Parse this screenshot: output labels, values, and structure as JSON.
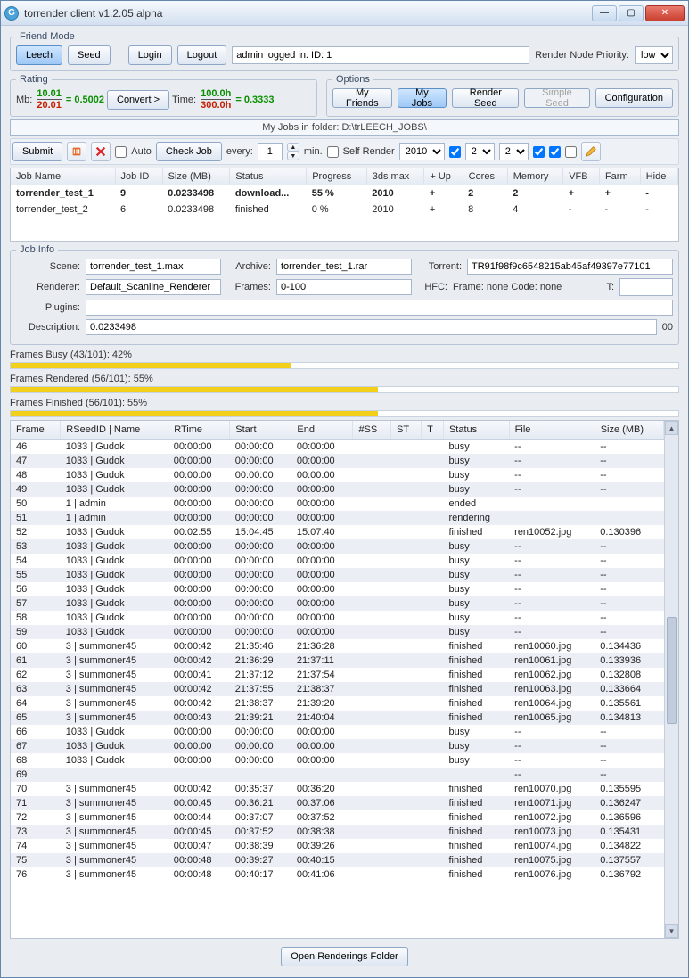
{
  "window": {
    "title": "torrender client v1.2.05 alpha"
  },
  "friendMode": {
    "legend": "Friend Mode",
    "leech": "Leech",
    "seed": "Seed",
    "login": "Login",
    "logout": "Logout",
    "status": "admin logged in. ID: 1",
    "priorityLabel": "Render Node Priority:",
    "priorityValue": "low"
  },
  "rating": {
    "legend": "Rating",
    "mbLabel": "Mb:",
    "mbTop": "10.01",
    "mbBot": "20.01",
    "mbEq": "= 0.5002",
    "convert": "Convert >",
    "timeLabel": "Time:",
    "timeTop": "100.0h",
    "timeBot": "300.0h",
    "timeEq": "= 0.3333"
  },
  "options": {
    "legend": "Options",
    "myFriends": "My Friends",
    "myJobs": "My Jobs",
    "renderSeed": "Render Seed",
    "simpleSeed": "Simple Seed",
    "configuration": "Configuration"
  },
  "jobs": {
    "path": "My Jobs in folder: D:\\trLEECH_JOBS\\",
    "submit": "Submit",
    "auto": "Auto",
    "checkJob": "Check Job",
    "every": "every:",
    "everyVal": "1",
    "min": "min.",
    "selfRender": "Self Render",
    "yearSel": "2010",
    "coresSel": "2",
    "memSel": "2",
    "headers": [
      "Job Name",
      "Job ID",
      "Size (MB)",
      "Status",
      "Progress",
      "3ds max",
      "+ Up",
      "Cores",
      "Memory",
      "VFB",
      "Farm",
      "Hide"
    ],
    "rows": [
      {
        "name": "torrender_test_1",
        "id": "9",
        "size": "0.0233498",
        "status": "download...",
        "prog": "55 %",
        "max": "2010",
        "up": "+",
        "cores": "2",
        "mem": "2",
        "vfb": "+",
        "farm": "+",
        "hide": "-",
        "bold": true
      },
      {
        "name": "torrender_test_2",
        "id": "6",
        "size": "0.0233498",
        "status": "finished",
        "prog": "0 %",
        "max": "2010",
        "up": "+",
        "cores": "8",
        "mem": "4",
        "vfb": "-",
        "farm": "-",
        "hide": "-",
        "bold": false
      }
    ]
  },
  "jobInfo": {
    "legend": "Job Info",
    "sceneL": "Scene:",
    "scene": "torrender_test_1.max",
    "archiveL": "Archive:",
    "archive": "torrender_test_1.rar",
    "torrentL": "Torrent:",
    "torrent": "TR91f98f9c6548215ab45af49397e77101",
    "rendererL": "Renderer:",
    "renderer": "Default_Scanline_Renderer",
    "framesL": "Frames:",
    "frames": "0-100",
    "hfcL": "HFC:",
    "hfc": "Frame: none Code: none",
    "tL": "T:",
    "t": "",
    "pluginsL": "Plugins:",
    "plugins": "",
    "descL": "Description:",
    "desc": "0.0233498",
    "descRight": "00"
  },
  "progress": {
    "busy": {
      "label": "Frames Busy (43/101): 42%",
      "pct": 42
    },
    "rendered": {
      "label": "Frames Rendered (56/101): 55%",
      "pct": 55
    },
    "finished": {
      "label": "Frames Finished (56/101): 55%",
      "pct": 55
    }
  },
  "frameHeaders": [
    "Frame",
    "RSeedID | Name",
    "RTime",
    "Start",
    "End",
    "#SS",
    "ST",
    "T",
    "Status",
    "File",
    "Size (MB)"
  ],
  "frames": [
    {
      "f": "46",
      "n": "1033 | Gudok",
      "rt": "00:00:00",
      "s": "00:00:00",
      "e": "00:00:00",
      "ss": "",
      "st": "",
      "t": "",
      "stat": "busy",
      "file": "--",
      "sz": "--"
    },
    {
      "f": "47",
      "n": "1033 | Gudok",
      "rt": "00:00:00",
      "s": "00:00:00",
      "e": "00:00:00",
      "ss": "",
      "st": "",
      "t": "",
      "stat": "busy",
      "file": "--",
      "sz": "--"
    },
    {
      "f": "48",
      "n": "1033 | Gudok",
      "rt": "00:00:00",
      "s": "00:00:00",
      "e": "00:00:00",
      "ss": "",
      "st": "",
      "t": "",
      "stat": "busy",
      "file": "--",
      "sz": "--"
    },
    {
      "f": "49",
      "n": "1033 | Gudok",
      "rt": "00:00:00",
      "s": "00:00:00",
      "e": "00:00:00",
      "ss": "",
      "st": "",
      "t": "",
      "stat": "busy",
      "file": "--",
      "sz": "--"
    },
    {
      "f": "50",
      "n": "1 | admin",
      "rt": "00:00:00",
      "s": "00:00:00",
      "e": "00:00:00",
      "ss": "",
      "st": "",
      "t": "",
      "stat": "ended",
      "file": "",
      "sz": ""
    },
    {
      "f": "51",
      "n": "1 | admin",
      "rt": "00:00:00",
      "s": "00:00:00",
      "e": "00:00:00",
      "ss": "",
      "st": "",
      "t": "",
      "stat": "rendering",
      "file": "",
      "sz": ""
    },
    {
      "f": "52",
      "n": "1033 | Gudok",
      "rt": "00:02:55",
      "s": "15:04:45",
      "e": "15:07:40",
      "ss": "",
      "st": "",
      "t": "",
      "stat": "finished",
      "file": "ren10052.jpg",
      "sz": "0.130396"
    },
    {
      "f": "53",
      "n": "1033 | Gudok",
      "rt": "00:00:00",
      "s": "00:00:00",
      "e": "00:00:00",
      "ss": "",
      "st": "",
      "t": "",
      "stat": "busy",
      "file": "--",
      "sz": "--"
    },
    {
      "f": "54",
      "n": "1033 | Gudok",
      "rt": "00:00:00",
      "s": "00:00:00",
      "e": "00:00:00",
      "ss": "",
      "st": "",
      "t": "",
      "stat": "busy",
      "file": "--",
      "sz": "--"
    },
    {
      "f": "55",
      "n": "1033 | Gudok",
      "rt": "00:00:00",
      "s": "00:00:00",
      "e": "00:00:00",
      "ss": "",
      "st": "",
      "t": "",
      "stat": "busy",
      "file": "--",
      "sz": "--"
    },
    {
      "f": "56",
      "n": "1033 | Gudok",
      "rt": "00:00:00",
      "s": "00:00:00",
      "e": "00:00:00",
      "ss": "",
      "st": "",
      "t": "",
      "stat": "busy",
      "file": "--",
      "sz": "--"
    },
    {
      "f": "57",
      "n": "1033 | Gudok",
      "rt": "00:00:00",
      "s": "00:00:00",
      "e": "00:00:00",
      "ss": "",
      "st": "",
      "t": "",
      "stat": "busy",
      "file": "--",
      "sz": "--"
    },
    {
      "f": "58",
      "n": "1033 | Gudok",
      "rt": "00:00:00",
      "s": "00:00:00",
      "e": "00:00:00",
      "ss": "",
      "st": "",
      "t": "",
      "stat": "busy",
      "file": "--",
      "sz": "--"
    },
    {
      "f": "59",
      "n": "1033 | Gudok",
      "rt": "00:00:00",
      "s": "00:00:00",
      "e": "00:00:00",
      "ss": "",
      "st": "",
      "t": "",
      "stat": "busy",
      "file": "--",
      "sz": "--"
    },
    {
      "f": "60",
      "n": "3 | summoner45",
      "rt": "00:00:42",
      "s": "21:35:46",
      "e": "21:36:28",
      "ss": "",
      "st": "",
      "t": "",
      "stat": "finished",
      "file": "ren10060.jpg",
      "sz": "0.134436"
    },
    {
      "f": "61",
      "n": "3 | summoner45",
      "rt": "00:00:42",
      "s": "21:36:29",
      "e": "21:37:11",
      "ss": "",
      "st": "",
      "t": "",
      "stat": "finished",
      "file": "ren10061.jpg",
      "sz": "0.133936"
    },
    {
      "f": "62",
      "n": "3 | summoner45",
      "rt": "00:00:41",
      "s": "21:37:12",
      "e": "21:37:54",
      "ss": "",
      "st": "",
      "t": "",
      "stat": "finished",
      "file": "ren10062.jpg",
      "sz": "0.132808"
    },
    {
      "f": "63",
      "n": "3 | summoner45",
      "rt": "00:00:42",
      "s": "21:37:55",
      "e": "21:38:37",
      "ss": "",
      "st": "",
      "t": "",
      "stat": "finished",
      "file": "ren10063.jpg",
      "sz": "0.133664"
    },
    {
      "f": "64",
      "n": "3 | summoner45",
      "rt": "00:00:42",
      "s": "21:38:37",
      "e": "21:39:20",
      "ss": "",
      "st": "",
      "t": "",
      "stat": "finished",
      "file": "ren10064.jpg",
      "sz": "0.135561"
    },
    {
      "f": "65",
      "n": "3 | summoner45",
      "rt": "00:00:43",
      "s": "21:39:21",
      "e": "21:40:04",
      "ss": "",
      "st": "",
      "t": "",
      "stat": "finished",
      "file": "ren10065.jpg",
      "sz": "0.134813"
    },
    {
      "f": "66",
      "n": "1033 | Gudok",
      "rt": "00:00:00",
      "s": "00:00:00",
      "e": "00:00:00",
      "ss": "",
      "st": "",
      "t": "",
      "stat": "busy",
      "file": "--",
      "sz": "--"
    },
    {
      "f": "67",
      "n": "1033 | Gudok",
      "rt": "00:00:00",
      "s": "00:00:00",
      "e": "00:00:00",
      "ss": "",
      "st": "",
      "t": "",
      "stat": "busy",
      "file": "--",
      "sz": "--"
    },
    {
      "f": "68",
      "n": "1033 | Gudok",
      "rt": "00:00:00",
      "s": "00:00:00",
      "e": "00:00:00",
      "ss": "",
      "st": "",
      "t": "",
      "stat": "busy",
      "file": "--",
      "sz": "--"
    },
    {
      "f": "69",
      "n": "",
      "rt": "",
      "s": "",
      "e": "",
      "ss": "",
      "st": "",
      "t": "",
      "stat": "",
      "file": "--",
      "sz": "--"
    },
    {
      "f": "70",
      "n": "3 | summoner45",
      "rt": "00:00:42",
      "s": "00:35:37",
      "e": "00:36:20",
      "ss": "",
      "st": "",
      "t": "",
      "stat": "finished",
      "file": "ren10070.jpg",
      "sz": "0.135595"
    },
    {
      "f": "71",
      "n": "3 | summoner45",
      "rt": "00:00:45",
      "s": "00:36:21",
      "e": "00:37:06",
      "ss": "",
      "st": "",
      "t": "",
      "stat": "finished",
      "file": "ren10071.jpg",
      "sz": "0.136247"
    },
    {
      "f": "72",
      "n": "3 | summoner45",
      "rt": "00:00:44",
      "s": "00:37:07",
      "e": "00:37:52",
      "ss": "",
      "st": "",
      "t": "",
      "stat": "finished",
      "file": "ren10072.jpg",
      "sz": "0.136596"
    },
    {
      "f": "73",
      "n": "3 | summoner45",
      "rt": "00:00:45",
      "s": "00:37:52",
      "e": "00:38:38",
      "ss": "",
      "st": "",
      "t": "",
      "stat": "finished",
      "file": "ren10073.jpg",
      "sz": "0.135431"
    },
    {
      "f": "74",
      "n": "3 | summoner45",
      "rt": "00:00:47",
      "s": "00:38:39",
      "e": "00:39:26",
      "ss": "",
      "st": "",
      "t": "",
      "stat": "finished",
      "file": "ren10074.jpg",
      "sz": "0.134822"
    },
    {
      "f": "75",
      "n": "3 | summoner45",
      "rt": "00:00:48",
      "s": "00:39:27",
      "e": "00:40:15",
      "ss": "",
      "st": "",
      "t": "",
      "stat": "finished",
      "file": "ren10075.jpg",
      "sz": "0.137557"
    },
    {
      "f": "76",
      "n": "3 | summoner45",
      "rt": "00:00:48",
      "s": "00:40:17",
      "e": "00:41:06",
      "ss": "",
      "st": "",
      "t": "",
      "stat": "finished",
      "file": "ren10076.jpg",
      "sz": "0.136792"
    }
  ],
  "footer": {
    "open": "Open Renderings Folder"
  }
}
